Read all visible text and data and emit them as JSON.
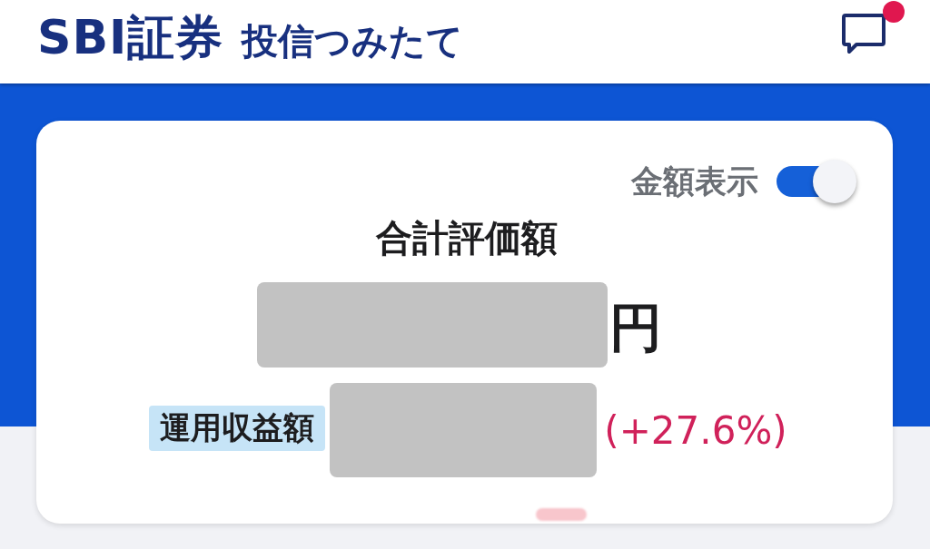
{
  "header": {
    "brand": "SBI証券",
    "service": "投信つみたて",
    "notifications": {
      "unread": true
    }
  },
  "summary": {
    "amount_display": {
      "label": "金額表示",
      "on": true
    },
    "title": "合計評価額",
    "total": {
      "redacted": true,
      "unit": "円"
    },
    "profit": {
      "label": "運用収益額",
      "redacted": true,
      "rate": "(+27.6%)"
    }
  }
}
